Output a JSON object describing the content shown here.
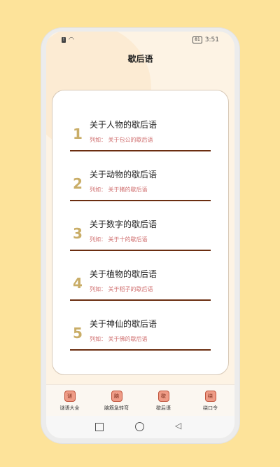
{
  "status_bar": {
    "time": "3:51",
    "battery": "81"
  },
  "app": {
    "title": "歇后语"
  },
  "items": [
    {
      "num": "1",
      "title": "关于人物的歇后语",
      "example": "列如： 关于包公的歇后语"
    },
    {
      "num": "2",
      "title": "关于动物的歇后语",
      "example": "列如： 关于猪的歇后语"
    },
    {
      "num": "3",
      "title": "关于数字的歇后语",
      "example": "列如： 关于十的歇后语"
    },
    {
      "num": "4",
      "title": "关于植物的歇后语",
      "example": "列如： 关于稻子的歇后语"
    },
    {
      "num": "5",
      "title": "关于神仙的歇后语",
      "example": "列如： 关于佛的歇后语"
    }
  ],
  "tabs": [
    {
      "label": "谜语大全",
      "icon": "谜"
    },
    {
      "label": "脑筋急转弯",
      "icon": "脑"
    },
    {
      "label": "歇后语",
      "icon": "歇"
    },
    {
      "label": "绕口令",
      "icon": "绕"
    }
  ],
  "colors": {
    "accent_number": "#c9ad67",
    "example_text": "#cf6c6c",
    "divider": "#6b2d10",
    "background": "#fde39a"
  }
}
